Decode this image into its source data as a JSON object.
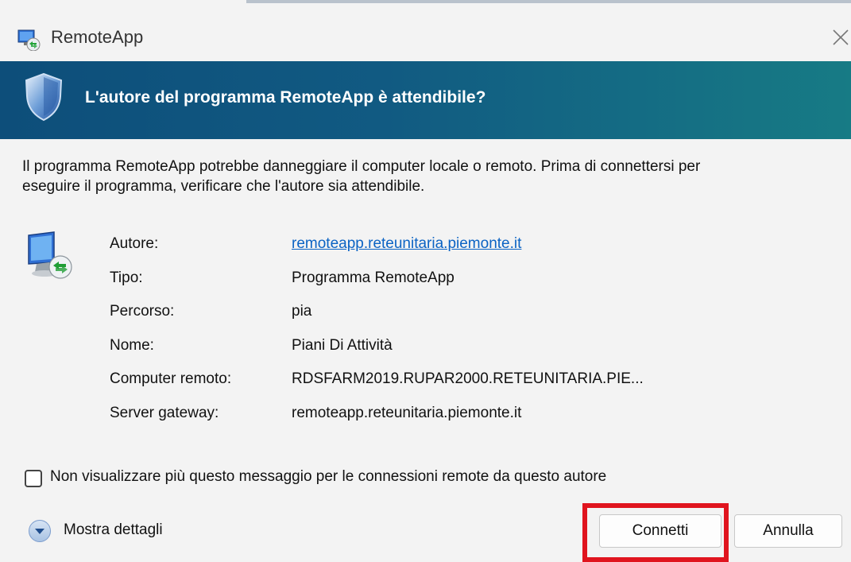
{
  "window": {
    "title": "RemoteApp"
  },
  "banner": {
    "heading": "L'autore del programma RemoteApp è attendibile?"
  },
  "description": {
    "line1": "Il programma RemoteApp potrebbe danneggiare il computer locale o remoto. Prima di connettersi per",
    "line2": "eseguire il programma, verificare che l'autore sia attendibile."
  },
  "details": [
    {
      "label": "Autore:",
      "value": "remoteapp.reteunitaria.piemonte.it"
    },
    {
      "label": "Tipo:",
      "value": "Programma RemoteApp"
    },
    {
      "label": "Percorso:",
      "value": "pia"
    },
    {
      "label": "Nome:",
      "value": "Piani Di Attività"
    },
    {
      "label": "Computer remoto:",
      "value": "RDSFARM2019.RUPAR2000.RETEUNITARIA.PIE..."
    },
    {
      "label": "Server gateway:",
      "value": "remoteapp.reteunitaria.piemonte.it"
    }
  ],
  "checkbox": {
    "label": "Non visualizzare più questo messaggio per le connessioni remote da questo autore",
    "checked": false
  },
  "footer": {
    "details_label": "Mostra dettagli",
    "connect_label": "Connetti",
    "cancel_label": "Annulla"
  },
  "colors": {
    "banner_start": "#0d4e7a",
    "banner_end": "#177b85",
    "link": "#0b63c4",
    "highlight": "#e0141e"
  },
  "icons": {
    "app": "remoteapp-icon",
    "close": "close-icon",
    "banner": "shield-icon",
    "computer": "remote-computer-icon",
    "expand": "chevron-down-icon"
  }
}
